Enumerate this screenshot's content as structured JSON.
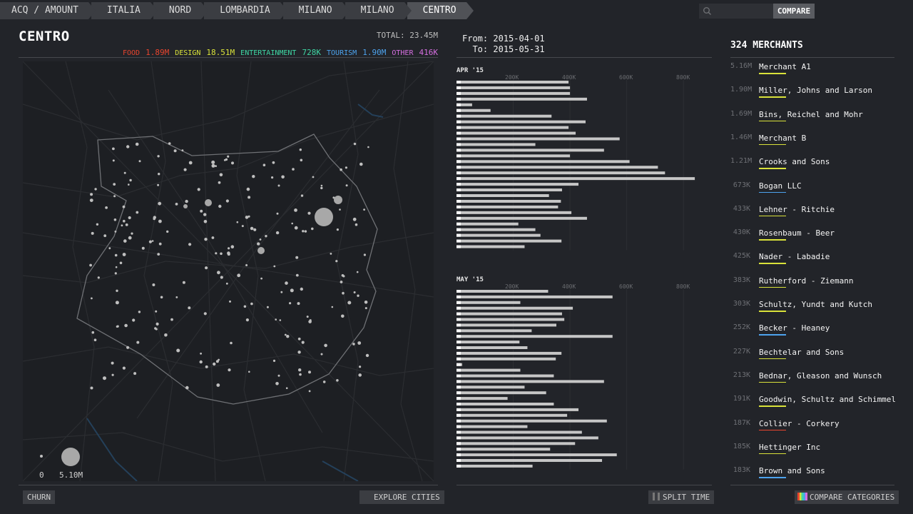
{
  "breadcrumbs": [
    "ACQ / AMOUNT",
    "ITALIA",
    "NORD",
    "LOMBARDIA",
    "MILANO",
    "MILANO",
    "CENTRO"
  ],
  "search": {
    "placeholder": ""
  },
  "compare_label": "COMPARE",
  "zone": {
    "title": "CENTRO",
    "total": "TOTAL: 23.45M",
    "categories": [
      {
        "name": "FOOD",
        "value": "1.89M",
        "color": "#e8452e"
      },
      {
        "name": "DESIGN",
        "value": "18.51M",
        "color": "#d9e23a"
      },
      {
        "name": "ENTERTAINMENT",
        "value": "728K",
        "color": "#3fd7a4"
      },
      {
        "name": "TOURISM",
        "value": "1.90M",
        "color": "#4da3ee"
      },
      {
        "name": "OTHER",
        "value": "416K",
        "color": "#d56fe0"
      }
    ]
  },
  "map_legend": {
    "min_label": "0",
    "max_label": "5.10M"
  },
  "buttons": {
    "churn": "CHURN",
    "explore_cities": "EXPLORE CITIES",
    "split_time": "SPLIT TIME",
    "compare_categories": "COMPARE CATEGORIES"
  },
  "dates": {
    "from_label": "From:",
    "from": "2015-04-01",
    "to_label": "To:",
    "to": "2015-05-31"
  },
  "chart_data": [
    {
      "type": "bar",
      "title": "APR '15",
      "xlim": [
        0,
        880000
      ],
      "ticks": [
        "200K",
        "400K",
        "600K",
        "800K"
      ],
      "values": [
        395000,
        400000,
        400000,
        460000,
        55000,
        120000,
        335000,
        455000,
        395000,
        420000,
        575000,
        278000,
        520000,
        400000,
        610000,
        710000,
        735000,
        840000,
        430000,
        372000,
        326000,
        368000,
        358000,
        405000,
        460000,
        218000,
        278000,
        296000,
        370000,
        240000
      ]
    },
    {
      "type": "bar",
      "title": "MAY '15",
      "xlim": [
        0,
        880000
      ],
      "ticks": [
        "200K",
        "400K",
        "600K",
        "800K"
      ],
      "values": [
        323000,
        550000,
        225000,
        410000,
        372000,
        380000,
        352000,
        265000,
        550000,
        222000,
        250000,
        370000,
        350000,
        20000,
        225000,
        343000,
        520000,
        240000,
        316000,
        180000,
        343000,
        430000,
        390000,
        530000,
        250000,
        442000,
        500000,
        418000,
        330000,
        565000,
        513000,
        268000
      ]
    }
  ],
  "merchants": {
    "title": "324 MERCHANTS",
    "items": [
      {
        "value": "5.16M",
        "name": "Merchant A1",
        "color": "#d9e23a"
      },
      {
        "value": "1.90M",
        "name": "Miller, Johns and Larson",
        "color": "#d9e23a"
      },
      {
        "value": "1.69M",
        "name": "Bins, Reichel and Mohr",
        "color": "#d9e23a"
      },
      {
        "value": "1.46M",
        "name": "Merchant B",
        "color": "#d9e23a"
      },
      {
        "value": "1.21M",
        "name": "Crooks and Sons",
        "color": "#d9e23a"
      },
      {
        "value": "673K",
        "name": "Bogan LLC",
        "color": "#4da3ee"
      },
      {
        "value": "433K",
        "name": "Lehner - Ritchie",
        "color": "#d9e23a"
      },
      {
        "value": "430K",
        "name": "Rosenbaum - Beer",
        "color": "#d9e23a"
      },
      {
        "value": "425K",
        "name": "Nader - Labadie",
        "color": "#d9e23a"
      },
      {
        "value": "383K",
        "name": "Rutherford - Ziemann",
        "color": "#d9e23a"
      },
      {
        "value": "303K",
        "name": "Schultz, Yundt and Kutch",
        "color": "#d9e23a"
      },
      {
        "value": "252K",
        "name": "Becker - Heaney",
        "color": "#4da3ee"
      },
      {
        "value": "227K",
        "name": "Bechtelar and Sons",
        "color": "#d9e23a"
      },
      {
        "value": "213K",
        "name": "Bednar, Gleason and Wunsch",
        "color": "#d9e23a"
      },
      {
        "value": "191K",
        "name": "Goodwin, Schultz and Schimmel",
        "color": "#d9e23a"
      },
      {
        "value": "187K",
        "name": "Collier - Corkery",
        "color": "#e8452e"
      },
      {
        "value": "185K",
        "name": "Hettinger Inc",
        "color": "#d9e23a"
      },
      {
        "value": "183K",
        "name": "Brown and Sons",
        "color": "#4da3ee"
      }
    ]
  }
}
